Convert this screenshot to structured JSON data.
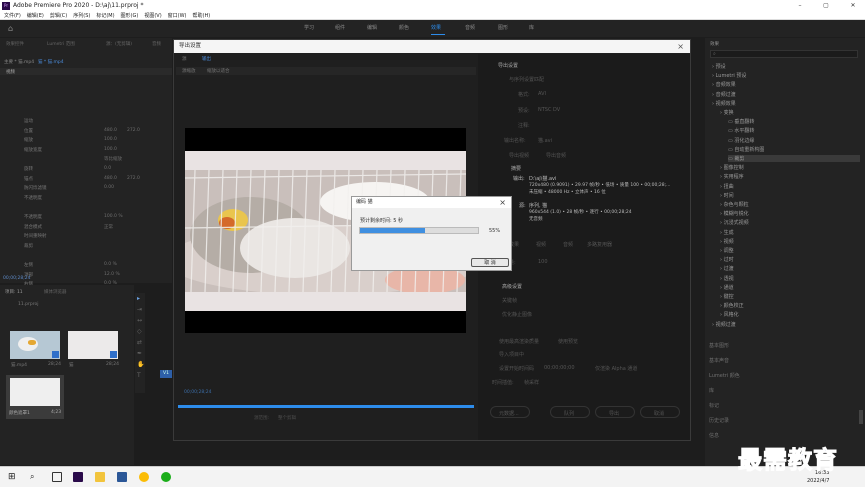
{
  "titlebar": {
    "title": "Adobe Premiere Pro 2020 - D:\\aj\\11.prproj *",
    "min": "–",
    "max": "▢",
    "close": "✕"
  },
  "menubar": [
    "文件(F)",
    "编辑(E)",
    "剪辑(C)",
    "序列(S)",
    "标记(M)",
    "图形(G)",
    "视图(V)",
    "窗口(W)",
    "帮助(H)"
  ],
  "workspaces": [
    "学习",
    "组件",
    "编辑",
    "颜色",
    "效果",
    "音频",
    "图形",
    "库"
  ],
  "active_workspace": "效果",
  "left_panel": {
    "tabs": [
      "效果控件",
      "Lumetri 范围",
      "源：(无剪辑)",
      "音频"
    ],
    "seq": "主要 * 猫.mp4",
    "clip": "猫 * 猫.mp4",
    "section_video": "视频",
    "rows": [
      {
        "label": "运动",
        "v1": "",
        "v2": ""
      },
      {
        "label": "位置",
        "v1": "480.0",
        "v2": "272.0"
      },
      {
        "label": "缩放",
        "v1": "100.0",
        "v2": ""
      },
      {
        "label": "缩放宽度",
        "v1": "100.0",
        "v2": ""
      },
      {
        "label": "",
        "v1": "等比缩放",
        "v2": ""
      },
      {
        "label": "旋转",
        "v1": "0.0",
        "v2": ""
      },
      {
        "label": "锚点",
        "v1": "480.0",
        "v2": "272.0"
      },
      {
        "label": "防闪烁滤镜",
        "v1": "0.00",
        "v2": ""
      },
      {
        "label": "不透明度",
        "v1": "",
        "v2": ""
      },
      {
        "label": "",
        "v1": "",
        "v2": ""
      },
      {
        "label": "不透明度",
        "v1": "100.0 %",
        "v2": ""
      },
      {
        "label": "混合模式",
        "v1": "正常",
        "v2": ""
      },
      {
        "label": "时间重映射",
        "v1": "",
        "v2": ""
      },
      {
        "label": "裁剪",
        "v1": "",
        "v2": ""
      },
      {
        "label": "",
        "v1": "",
        "v2": ""
      },
      {
        "label": "左侧",
        "v1": "0.0 %",
        "v2": ""
      },
      {
        "label": "顶部",
        "v1": "12.0 %",
        "v2": ""
      },
      {
        "label": "右侧",
        "v1": "0.0 %",
        "v2": ""
      },
      {
        "label": "底部",
        "v1": "12.0 %",
        "v2": ""
      },
      {
        "label": "",
        "v1": "缩放",
        "v2": ""
      },
      {
        "label": "羽化边缘",
        "v1": "0",
        "v2": ""
      }
    ],
    "timecode": "00;00;28;24"
  },
  "project": {
    "tabs": [
      "项目: 11",
      "媒体浏览器"
    ],
    "file": "11.prproj",
    "items": [
      {
        "name": "猫.mp4",
        "dur": "28;24"
      },
      {
        "name": "猫",
        "dur": "28;24"
      },
      {
        "name": "颜色遮罩1",
        "dur": "4;23"
      }
    ]
  },
  "export": {
    "title": "导出设置",
    "tabs": [
      "源",
      "输出"
    ],
    "src_scale": "源缩放",
    "src_scale_val": "缩放以适合",
    "settings_title": "导出设置",
    "match_seq": "与序列设置匹配",
    "format_label": "格式:",
    "format_val": "AVI",
    "preset_label": "预设:",
    "preset_val": "NTSC DV",
    "comment_label": "注释:",
    "output_label": "输出名称:",
    "output_val": "猫.avi",
    "export_video": "导出视频",
    "export_audio": "导出音频",
    "summary": "摘要",
    "out_label": "输出:",
    "out_path": "D:\\aj\\猫.avi",
    "out_line1": "720x480 (0.9091) • 29.97 帧/秒 • 低场 • 质量 100 • 00;00;28;...",
    "out_line2": "未压缩 • 48000 Hz • 立体声 • 16 位",
    "src_label": "源:",
    "src_name": "序列, 猫",
    "src_line1": "960x544 (1.0) • 28 帧/秒 • 逐行 • 00;00;28;24",
    "src_line2": "无音频",
    "tabs2": [
      "效果",
      "视频",
      "音频",
      "多路复用器",
      "字幕",
      "发布"
    ],
    "basic_video": "基本视频设置",
    "codec_label": "视频编解码器:",
    "quality_label": "质量:",
    "quality_val": "100",
    "advanced_title": "高级设置",
    "key_frame": "关键帧",
    "optimize": "优化静止图像",
    "max_render": "使用最高渲染质量",
    "use_preview": "使用预览",
    "import_proj": "导入项目中",
    "set_start_tc": "设置开始时间码",
    "start_tc": "00;00;00;00",
    "render_alpha": "仅渲染 Alpha 通道",
    "time_interp": "时间插值:",
    "time_interp_val": "帧采样",
    "btn_metadata": "元数据...",
    "btn_queue": "队列",
    "btn_export": "导出",
    "btn_cancel": "取消",
    "in_tc": "00;00;28;24",
    "source_range": "源范围:",
    "source_range_val": "整个剪辑"
  },
  "encoding": {
    "title": "编码 猫",
    "remaining": "预计剩余时间: 5 秒",
    "percent": "55%",
    "progress": 0.55,
    "cancel": "取 消"
  },
  "effects": {
    "title": "效果",
    "items": [
      {
        "label": "预设",
        "indent": 0
      },
      {
        "label": "Lumetri 预设",
        "indent": 0
      },
      {
        "label": "音频效果",
        "indent": 0
      },
      {
        "label": "音频过渡",
        "indent": 0
      },
      {
        "label": "视频效果",
        "indent": 0
      },
      {
        "label": "变换",
        "indent": 1
      },
      {
        "label": "垂直翻转",
        "indent": 2
      },
      {
        "label": "水平翻转",
        "indent": 2
      },
      {
        "label": "羽化边缘",
        "indent": 2
      },
      {
        "label": "自动重新构图",
        "indent": 2
      },
      {
        "label": "裁剪",
        "indent": 2
      },
      {
        "label": "图像控制",
        "indent": 1
      },
      {
        "label": "实用程序",
        "indent": 1
      },
      {
        "label": "扭曲",
        "indent": 1
      },
      {
        "label": "时间",
        "indent": 1
      },
      {
        "label": "杂色与颗粒",
        "indent": 1
      },
      {
        "label": "模糊与锐化",
        "indent": 1
      },
      {
        "label": "沉浸式视频",
        "indent": 1
      },
      {
        "label": "生成",
        "indent": 1
      },
      {
        "label": "视频",
        "indent": 1
      },
      {
        "label": "调整",
        "indent": 1
      },
      {
        "label": "过时",
        "indent": 1
      },
      {
        "label": "过渡",
        "indent": 1
      },
      {
        "label": "透视",
        "indent": 1
      },
      {
        "label": "通道",
        "indent": 1
      },
      {
        "label": "键控",
        "indent": 1
      },
      {
        "label": "颜色校正",
        "indent": 1
      },
      {
        "label": "风格化",
        "indent": 1
      },
      {
        "label": "视频过渡",
        "indent": 0
      }
    ],
    "lower": [
      "基本图形",
      "基本声音",
      "Lumetri 颜色",
      "库",
      "标记",
      "历史记录",
      "信息"
    ]
  },
  "timeline": {
    "v1": "V1"
  },
  "taskbar": {
    "time": "16:33",
    "date": "2022/4/7"
  },
  "watermark": "最需教育"
}
